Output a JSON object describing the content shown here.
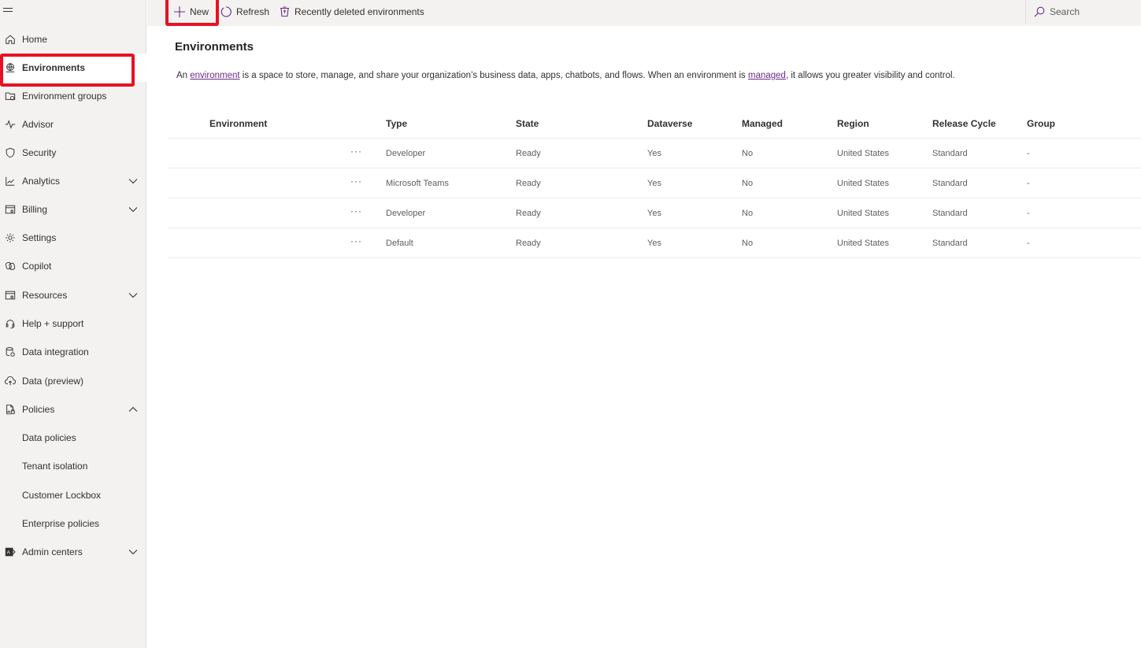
{
  "sidebar": {
    "menu_icon": "hamburger-icon",
    "items": [
      {
        "label": "Home",
        "icon": "home-icon"
      },
      {
        "label": "Environments",
        "icon": "globe-icon",
        "active": true
      },
      {
        "label": "Environment groups",
        "icon": "folder-globe-icon"
      },
      {
        "label": "Advisor",
        "icon": "pulse-icon"
      },
      {
        "label": "Security",
        "icon": "shield-icon"
      },
      {
        "label": "Analytics",
        "icon": "chart-line-icon",
        "chevron": "down"
      },
      {
        "label": "Billing",
        "icon": "billing-icon",
        "chevron": "down"
      },
      {
        "label": "Settings",
        "icon": "gear-icon"
      },
      {
        "label": "Copilot",
        "icon": "copilot-icon"
      },
      {
        "label": "Resources",
        "icon": "resources-icon",
        "chevron": "down"
      },
      {
        "label": "Help + support",
        "icon": "headset-icon"
      },
      {
        "label": "Data integration",
        "icon": "database-icon"
      },
      {
        "label": "Data (preview)",
        "icon": "cloud-upload-icon"
      },
      {
        "label": "Policies",
        "icon": "policy-document-icon",
        "chevron": "up"
      },
      {
        "label": "Data policies",
        "sub": true
      },
      {
        "label": "Tenant isolation",
        "sub": true
      },
      {
        "label": "Customer Lockbox",
        "sub": true
      },
      {
        "label": "Enterprise policies",
        "sub": true
      },
      {
        "label": "Admin centers",
        "icon": "admin-centers-icon",
        "chevron": "down"
      }
    ]
  },
  "commandbar": {
    "new_label": "New",
    "refresh_label": "Refresh",
    "recently_deleted_label": "Recently deleted environments",
    "search_placeholder": "Search"
  },
  "main": {
    "title": "Environments",
    "description": {
      "prefix": "An ",
      "link1": "environment",
      "middle": " is a space to store, manage, and share your organization’s business data, apps, chatbots, and flows. When an environment is ",
      "link2": "managed",
      "suffix": ", it allows you greater visibility and control."
    },
    "table": {
      "columns": [
        "Environment",
        "Type",
        "State",
        "Dataverse",
        "Managed",
        "Region",
        "Release Cycle",
        "Group"
      ],
      "more_label": "···",
      "rows": [
        {
          "environment": "",
          "type": "Developer",
          "state": "Ready",
          "dataverse": "Yes",
          "managed": "No",
          "region": "United States",
          "release_cycle": "Standard",
          "group": "-"
        },
        {
          "environment": "",
          "type": "Microsoft Teams",
          "state": "Ready",
          "dataverse": "Yes",
          "managed": "No",
          "region": "United States",
          "release_cycle": "Standard",
          "group": "-"
        },
        {
          "environment": "",
          "type": "Developer",
          "state": "Ready",
          "dataverse": "Yes",
          "managed": "No",
          "region": "United States",
          "release_cycle": "Standard",
          "group": "-"
        },
        {
          "environment": "",
          "type": "Default",
          "state": "Ready",
          "dataverse": "Yes",
          "managed": "No",
          "region": "United States",
          "release_cycle": "Standard",
          "group": "-"
        }
      ]
    }
  },
  "colors": {
    "highlight": "#e81123",
    "accent": "#6b2a8a",
    "sidebar_bg": "#f3f2f1"
  }
}
